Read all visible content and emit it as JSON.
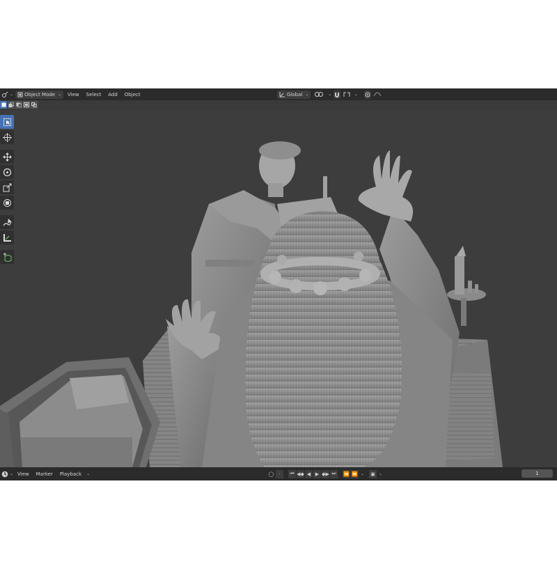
{
  "header": {
    "mode_label": "Object Mode",
    "menus": [
      "View",
      "Select",
      "Add",
      "Object"
    ],
    "transform_orientation": "Global"
  },
  "timeline": {
    "menus": [
      "View",
      "Marker",
      "Playback"
    ],
    "current_frame": "1"
  },
  "icons": {
    "editor_type": "view3d-editor-icon",
    "tools": [
      "select-box-icon",
      "cursor-icon",
      "move-icon",
      "rotate-icon",
      "scale-icon",
      "transform-icon",
      "annotate-icon",
      "measure-icon",
      "add-cube-icon"
    ]
  },
  "colors": {
    "header_bg": "#2b2b2b",
    "viewport_bg": "#3d3d3d",
    "active_blue": "#4772b3",
    "model_gray": "#8a8a8a"
  }
}
